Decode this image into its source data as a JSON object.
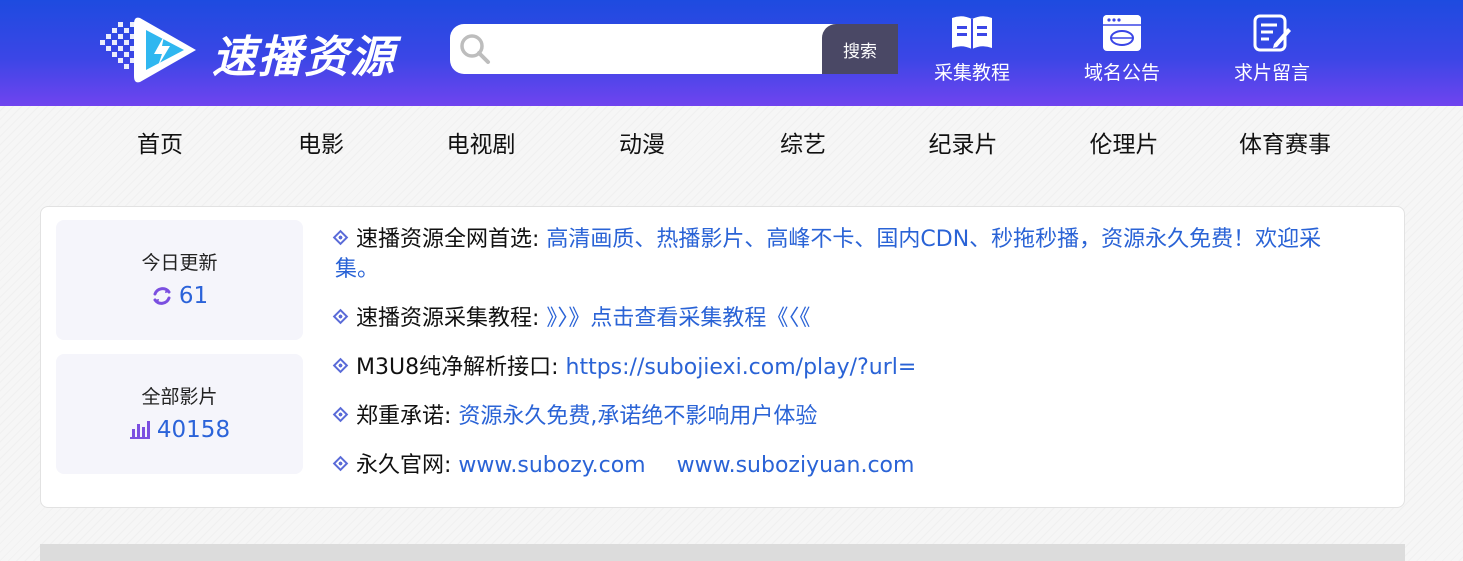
{
  "brand": {
    "name": "速播资源"
  },
  "search": {
    "placeholder": "",
    "button_label": "搜索"
  },
  "header_links": [
    {
      "label": "采集教程",
      "icon": "book-icon"
    },
    {
      "label": "域名公告",
      "icon": "browser-www-icon"
    },
    {
      "label": "求片留言",
      "icon": "edit-note-icon"
    }
  ],
  "nav": [
    "首页",
    "电影",
    "电视剧",
    "动漫",
    "综艺",
    "纪录片",
    "伦理片",
    "体育赛事"
  ],
  "stats": [
    {
      "label": "今日更新",
      "value": "61",
      "icon": "refresh-icon"
    },
    {
      "label": "全部影片",
      "value": "40158",
      "icon": "bar-chart-icon"
    }
  ],
  "notices": [
    {
      "title": "速播资源全网首选:",
      "text": "高清画质、热播影片、高峰不卡、国内CDN、秒拖秒播，资源永久免费！欢迎采集。"
    },
    {
      "title": "速播资源采集教程:",
      "text": "》〉》点击查看采集教程《〈《"
    },
    {
      "title": "M3U8纯净解析接口:",
      "text": "https://subojiexi.com/play/?url="
    },
    {
      "title": "郑重承诺:",
      "text": "资源永久免费,承诺绝不影响用户体验"
    },
    {
      "title": "永久官网:",
      "link1": "www.subozy.com",
      "link2": "www.suboziyuan.com"
    }
  ],
  "colors": {
    "header_top": "#1e4be0",
    "header_bottom": "#7044ef",
    "link": "#2a63d6",
    "search_button": "#4a4865"
  }
}
